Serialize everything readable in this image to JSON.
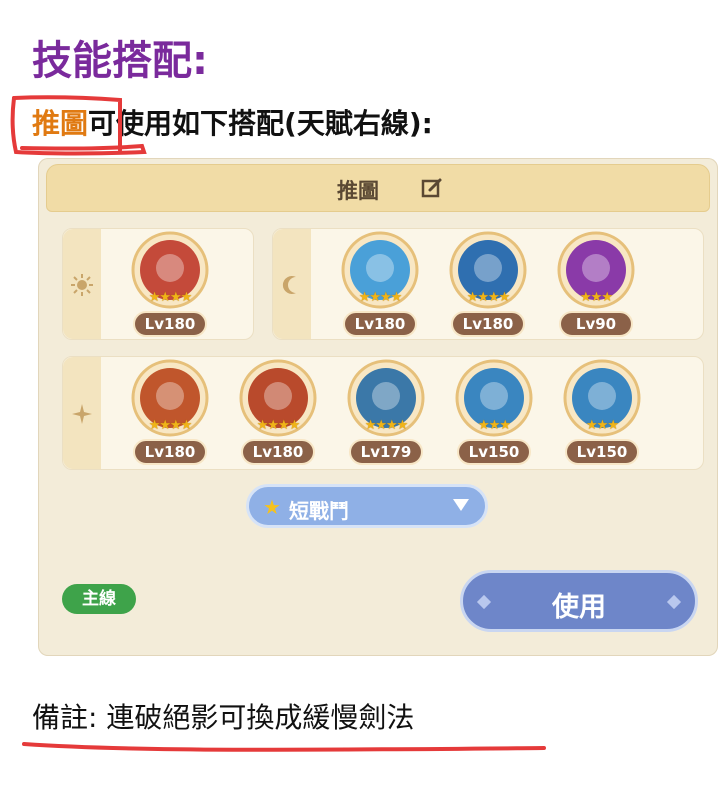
{
  "heading": "技能搭配:",
  "intro": {
    "highlight": "推圖",
    "rest": "可使用如下搭配(天賦右線):"
  },
  "panel": {
    "title": "推圖",
    "groups": [
      {
        "name": "sun",
        "icon": "sun-icon",
        "skills": [
          {
            "level": "Lv180",
            "stars": "★★★★",
            "color": "#c44a3a"
          }
        ]
      },
      {
        "name": "moon",
        "icon": "moon-icon",
        "skills": [
          {
            "level": "Lv180",
            "stars": "★★★★",
            "color": "#4aa0d8"
          },
          {
            "level": "Lv180",
            "stars": "★★★★",
            "color": "#2f6fb0"
          },
          {
            "level": "Lv90",
            "stars": "★★★",
            "color": "#8a3aa8"
          }
        ]
      },
      {
        "name": "star",
        "icon": "sparkle-icon",
        "skills": [
          {
            "level": "Lv180",
            "stars": "★★★★",
            "color": "#c0562c"
          },
          {
            "level": "Lv180",
            "stars": "★★★★",
            "color": "#b94a2c"
          },
          {
            "level": "Lv179",
            "stars": "★★★★",
            "color": "#3b78a8"
          },
          {
            "level": "Lv150",
            "stars": "★★★",
            "color": "#3a86c0"
          },
          {
            "level": "Lv150",
            "stars": "★★★",
            "color": "#3a86c0"
          }
        ]
      }
    ],
    "weapon_select": {
      "value": "短戰鬥"
    },
    "route_badge": "主線",
    "use_button": "使用"
  },
  "note": "備註: 連破絕影可換成緩慢劍法",
  "colors": {
    "heading": "#7a2a9c",
    "highlight": "#e07a12",
    "annotation": "#e53a3a"
  }
}
